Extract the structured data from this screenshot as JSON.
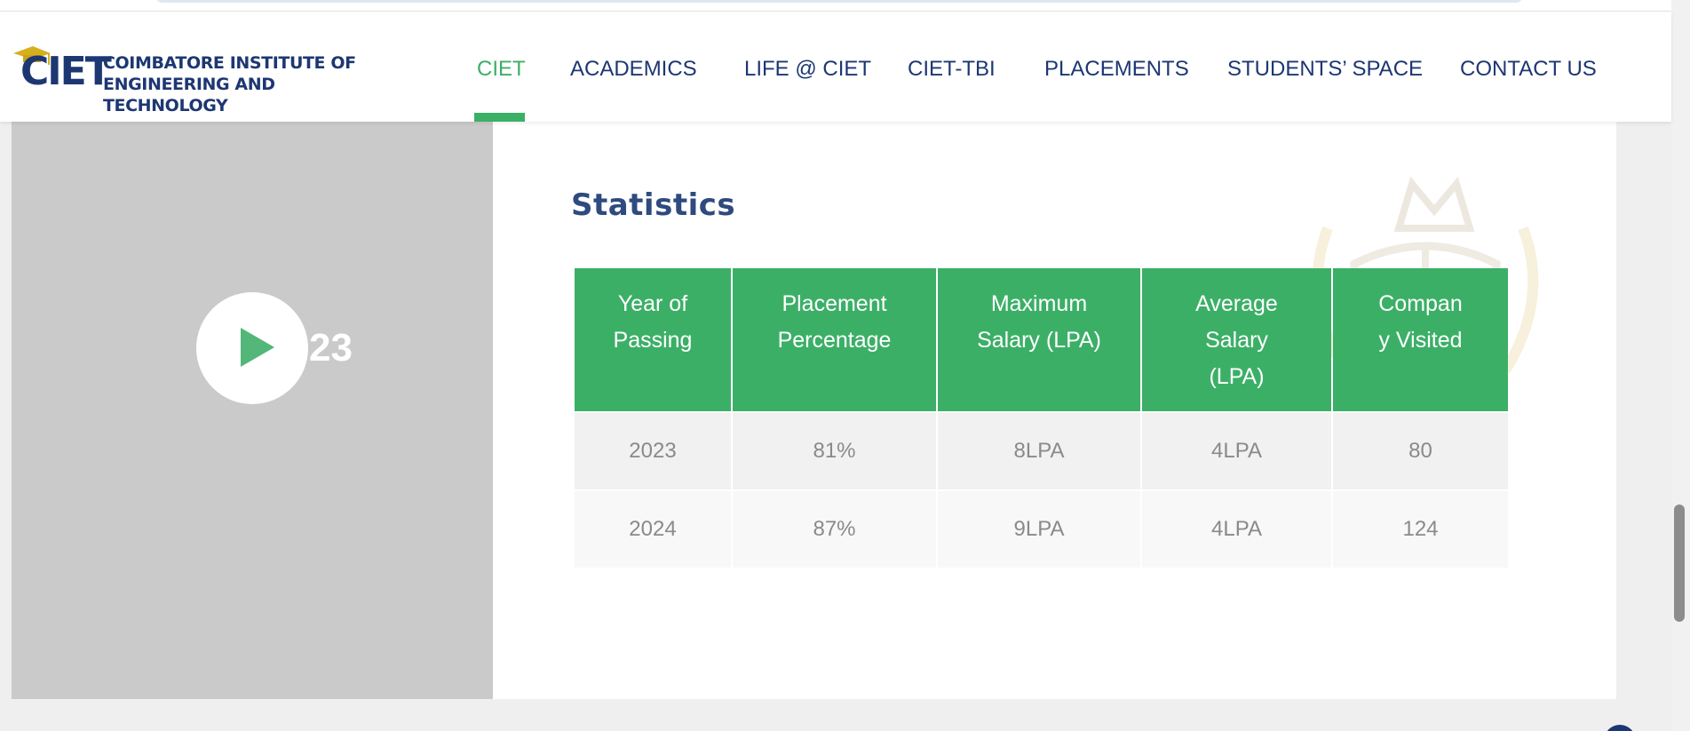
{
  "logo": {
    "short": "CIET",
    "line1": "COIMBATORE INSTITUTE OF",
    "line2": "ENGINEERING AND TECHNOLOGY"
  },
  "nav": {
    "items": [
      {
        "label": "CIET",
        "active": true
      },
      {
        "label": "ACADEMICS",
        "active": false
      },
      {
        "label": "LIFE @ CIET",
        "active": false
      },
      {
        "label": "CIET-TBI",
        "active": false
      },
      {
        "label": "PLACEMENTS",
        "active": false
      },
      {
        "label": "STUDENTS’ SPACE",
        "active": false
      },
      {
        "label": "CONTACT US",
        "active": false
      }
    ]
  },
  "video": {
    "overlay_text": "23"
  },
  "stats": {
    "title": "Statistics",
    "headers": [
      [
        "Year of",
        "Passing"
      ],
      [
        "Placement",
        "Percentage"
      ],
      [
        "Maximum",
        "Salary (LPA)"
      ],
      [
        "Average",
        "Salary",
        "(LPA)"
      ],
      [
        "Compan",
        "y Visited"
      ]
    ],
    "rows": [
      [
        "2023",
        "81%",
        "8LPA",
        "4LPA",
        "80"
      ],
      [
        "2024",
        "87%",
        "9LPA",
        "4LPA",
        "124"
      ]
    ]
  },
  "colors": {
    "brand_green": "#3caf67",
    "brand_navy": "#1d3772",
    "title_blue": "#2e4a7f",
    "video_bg": "#cacaca"
  },
  "icons": {
    "logo_cap": "graduation-cap-icon",
    "play": "play-icon",
    "watermark": "emblem-watermark-icon"
  }
}
